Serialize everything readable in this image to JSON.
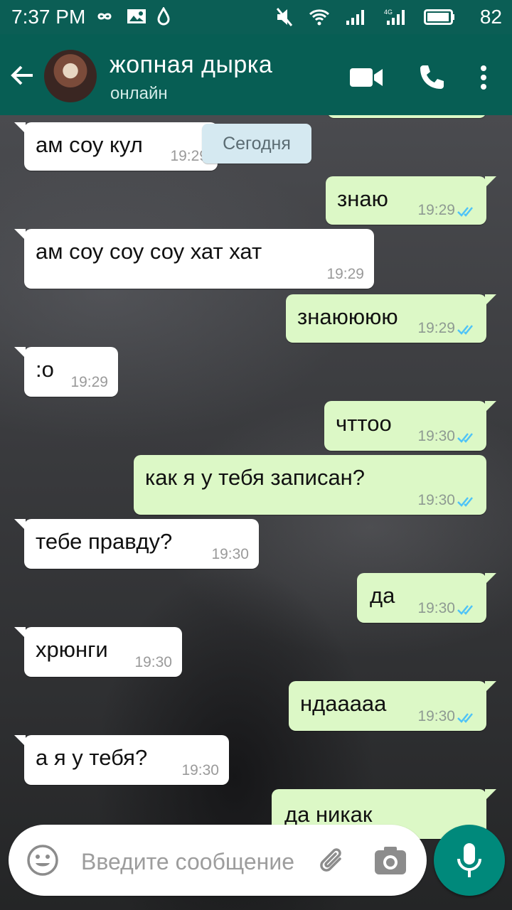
{
  "status_bar": {
    "time": "7:37 PM",
    "battery": "82",
    "icons_left": [
      "infinity-icon",
      "image-icon",
      "drop-icon"
    ],
    "icons_right": [
      "mute-icon",
      "wifi-icon",
      "signal-icon",
      "signal-4g-icon",
      "battery-icon"
    ]
  },
  "header": {
    "title": "жопная дырка",
    "status": "онлайн",
    "icons": [
      "back-arrow-icon",
      "video-call-icon",
      "phone-icon",
      "more-vert-icon"
    ]
  },
  "date_chip": "Сегодня",
  "messages": [
    {
      "dir": "out",
      "text": "",
      "time": ""
    },
    {
      "dir": "in",
      "text": "ам соу кул",
      "time": "19:29"
    },
    {
      "dir": "out",
      "text": "знаю",
      "time": "19:29"
    },
    {
      "dir": "in",
      "text": "ам соу соу соу хат хат",
      "time": "19:29"
    },
    {
      "dir": "out",
      "text": "знаюююю",
      "time": "19:29"
    },
    {
      "dir": "in",
      "text": ":o",
      "time": "19:29"
    },
    {
      "dir": "out",
      "text": "чттоо",
      "time": "19:30"
    },
    {
      "dir": "out",
      "text": "как я у тебя записан?",
      "time": "19:30"
    },
    {
      "dir": "in",
      "text": "тебе правду?",
      "time": "19:30"
    },
    {
      "dir": "out",
      "text": "да",
      "time": "19:30"
    },
    {
      "dir": "in",
      "text": "хрюнги",
      "time": "19:30"
    },
    {
      "dir": "out",
      "text": "ндааааа",
      "time": "19:30"
    },
    {
      "dir": "in",
      "text": "а я у тебя?",
      "time": "19:30"
    },
    {
      "dir": "out",
      "text": "да никак",
      "time": ""
    }
  ],
  "input": {
    "placeholder": "Введите сообщение"
  },
  "colors": {
    "header": "#075e54",
    "status_bar": "#0b5e55",
    "bubble_in": "#ffffff",
    "bubble_out": "#dcf8c6",
    "ticks": "#4fc3f7",
    "mic_button": "#00897b"
  }
}
